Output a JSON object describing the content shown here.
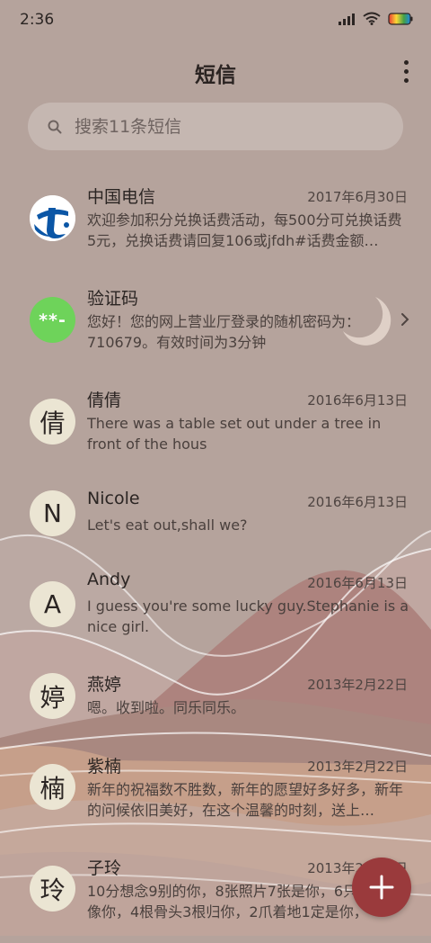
{
  "status_bar": {
    "time": "2:36"
  },
  "header": {
    "title": "短信"
  },
  "search": {
    "placeholder": "搜索11条短信"
  },
  "conversations": [
    {
      "name": "中国电信",
      "date": "2017年6月30日",
      "preview": "欢迎参加积分兑换话费活动，每500分可兑换话费5元，兑换话费请回复106或jfdh#话费金额…",
      "avatar": "telecom-logo"
    },
    {
      "name": "验证码",
      "date": "",
      "preview": "您好！您的网上营业厅登录的随机密码为：710679。有效时间为3分钟",
      "avatar_text": "**-"
    },
    {
      "name": "倩倩",
      "date": "2016年6月13日",
      "preview": "There was a table set out under a tree in front of the hous",
      "avatar_text": "倩"
    },
    {
      "name": "Nicole",
      "date": "2016年6月13日",
      "preview": "Let's eat out,shall we?",
      "avatar_text": "N"
    },
    {
      "name": "Andy",
      "date": "2016年6月13日",
      "preview": "I guess you're some lucky guy.Stephanie is a nice girl.",
      "avatar_text": "A"
    },
    {
      "name": "燕婷",
      "date": "2013年2月22日",
      "preview": "嗯。收到啦。同乐同乐。",
      "avatar_text": "婷"
    },
    {
      "name": "紫楠",
      "date": "2013年2月22日",
      "preview": "新年的祝福数不胜数，新年的愿望好多好多，新年的问候依旧美好，在这个温馨的时刻，送上…",
      "avatar_text": "楠"
    },
    {
      "name": "子玲",
      "date": "2013年2月22日",
      "preview": "10分想念9别的你，8张照片7张是你，6只兔子只像你，4根骨头3根归你，2爪着地1定是你，",
      "avatar_text": "玲"
    }
  ],
  "fab": {
    "icon": "plus-icon"
  },
  "colors": {
    "background": "#b5a39c",
    "fab": "#9a3a3c",
    "code_avatar": "#6ed35a",
    "telecom_blue": "#0b56a6"
  }
}
